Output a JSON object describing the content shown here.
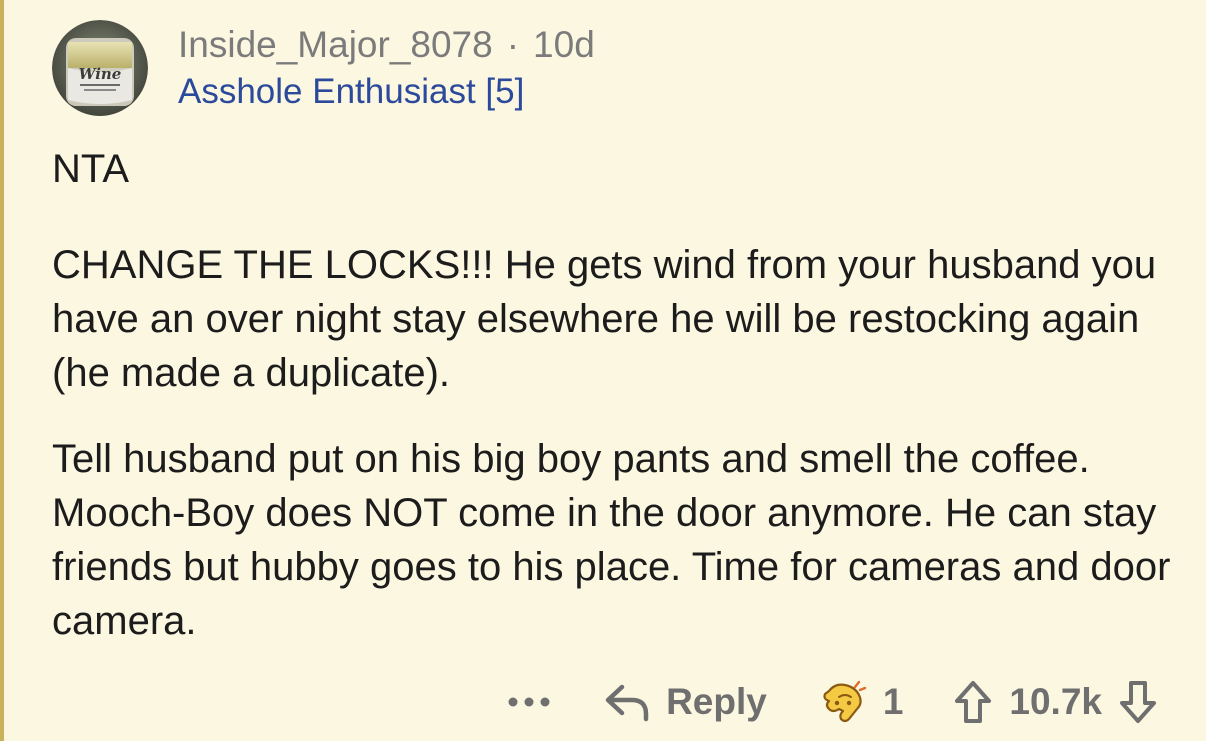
{
  "comment": {
    "username": "Inside_Major_8078",
    "separator": "·",
    "age": "10d",
    "flair": "Asshole Enthusiast [5]",
    "avatar_icon": "wine-glass-avatar",
    "paragraphs": [
      "NTA",
      "CHANGE THE LOCKS!!! He gets wind from your husband you have an over night stay elsewhere he will be restocking again (he made a duplicate).",
      "Tell husband put on his big boy pants and smell the coffee. Mooch-Boy does NOT come in the door anymore. He can stay friends but  hubby goes to his place. Time for cameras and door camera."
    ]
  },
  "actions": {
    "more_icon": "more-dots-icon",
    "reply_label": "Reply",
    "reply_icon": "reply-arrow-icon",
    "award_icon": "award-icon",
    "award_count": "1",
    "upvote_icon": "upvote-arrow-icon",
    "score": "10.7k",
    "downvote_icon": "downvote-arrow-icon"
  },
  "colors": {
    "background": "#fcf7e1",
    "username": "#7b7b7b",
    "flair": "#2b4a9b",
    "body_text": "#1c1c1c",
    "action_text": "#6f6f6f",
    "thread_line": "#c9b25c"
  }
}
